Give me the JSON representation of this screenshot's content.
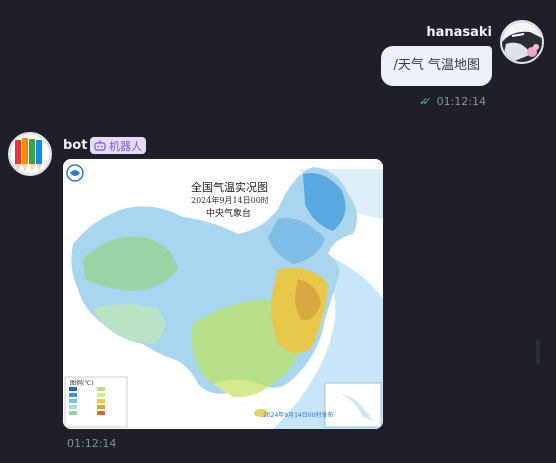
{
  "user": {
    "name": "hanasaki",
    "avatar_icon": "anime-avatar-icon",
    "message": "/天气 气温地图",
    "time": "01:12:14",
    "status_icon": "double-check-icon",
    "status_color": "#46c08a"
  },
  "bot": {
    "name": "bot",
    "avatar_icon": "colored-pencils-icon",
    "badge_label": "机器人",
    "badge_icon": "robot-icon",
    "time": "01:12:14"
  },
  "map": {
    "title": "全国气温实况图",
    "date": "2024年9月14日00时",
    "issuer": "中央气象台",
    "legend_title": "图例(℃)",
    "stamp": "2024年9月14日00时发布",
    "colors": {
      "hot": "#e8c84a",
      "warm": "#b6e08a",
      "mild": "#98d4a6",
      "cool": "#a9d6ee",
      "cold": "#5aa8e0",
      "sea": "#c7e6fb"
    }
  },
  "colors": {
    "background": "#1e1f29",
    "bubble": "#eef0f8",
    "badge_bg": "#e4dcfa",
    "badge_text": "#7a5cd6"
  }
}
